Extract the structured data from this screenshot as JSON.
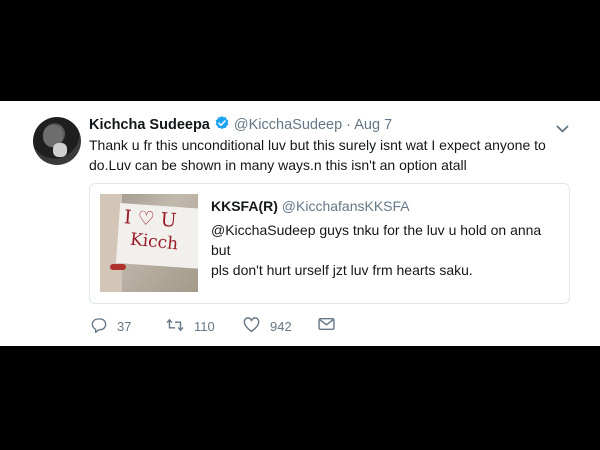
{
  "tweet": {
    "author_name": "Kichcha Sudeepa",
    "handle": "@KicchaSudeep",
    "separator": "·",
    "date": "Aug 7",
    "text_line1": "Thank u fr this unconditional luv but this surely isnt wat I expect anyone to",
    "text_line2": "do.Luv can be shown in many ways.n this isn't an option atall",
    "verified_color": "#1da1f2",
    "icons": {
      "avatar": "avatar-image",
      "verified": "verified-badge-icon",
      "more": "chevron-down-icon",
      "reply": "reply-icon",
      "retweet": "retweet-icon",
      "like": "heart-icon",
      "message": "mail-icon"
    }
  },
  "quoted_tweet": {
    "author_name": "KKSFA(R)",
    "handle": "@KicchafansKKSFA",
    "text_line1": "@KicchaSudeep guys tnku for the luv u hold on anna but",
    "text_line2": "pls don't hurt urself jzt luv frm hearts saku.",
    "image_words": [
      "I ♡ U",
      "Kicch"
    ]
  },
  "actions": {
    "replies": "37",
    "retweets": "110",
    "likes": "942"
  }
}
